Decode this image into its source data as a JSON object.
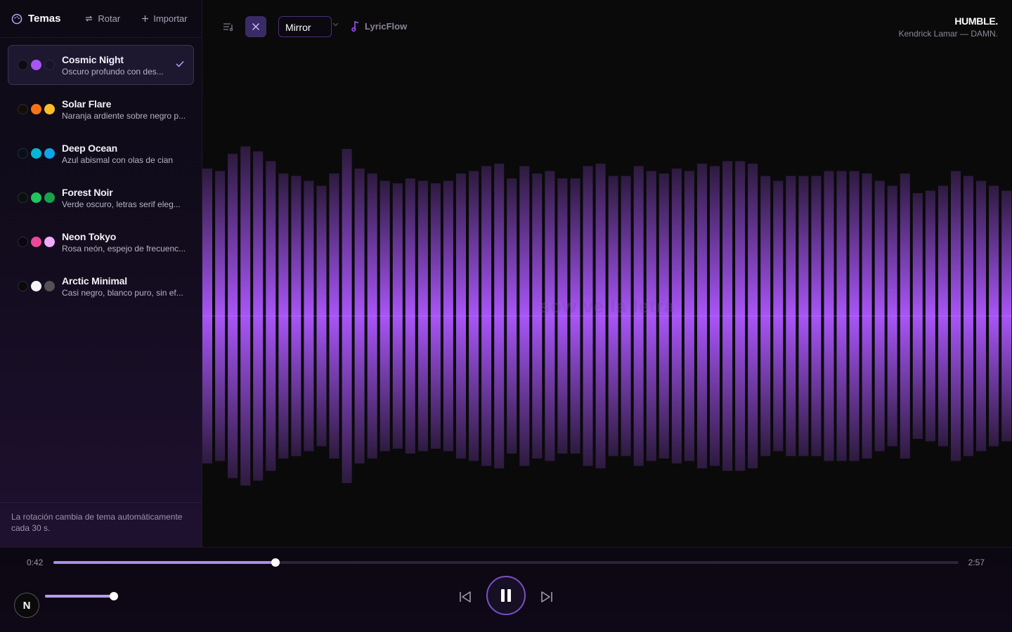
{
  "sidebar": {
    "tabs": {
      "temas": "Temas",
      "rotar": "Rotar",
      "importar": "Importar"
    },
    "themes": [
      {
        "name": "Cosmic Night",
        "desc": "Oscuro profundo con des...",
        "active": true,
        "colors": [
          "#0e0a14",
          "#a855f7",
          "#1a1230"
        ]
      },
      {
        "name": "Solar Flare",
        "desc": "Naranja ardiente sobre negro p...",
        "active": false,
        "colors": [
          "#150c06",
          "#f97316",
          "#fbbf24"
        ]
      },
      {
        "name": "Deep Ocean",
        "desc": "Azul abismal con olas de cian",
        "active": false,
        "colors": [
          "#06101a",
          "#06b6d4",
          "#0ea5e9"
        ]
      },
      {
        "name": "Forest Noir",
        "desc": "Verde oscuro, letras serif eleg...",
        "active": false,
        "colors": [
          "#07110a",
          "#22c55e",
          "#16a34a"
        ]
      },
      {
        "name": "Neon Tokyo",
        "desc": "Rosa neón, espejo de frecuenc...",
        "active": false,
        "colors": [
          "#0a0610",
          "#ec4899",
          "#f0abfc"
        ]
      },
      {
        "name": "Arctic Minimal",
        "desc": "Casi negro, blanco puro, sin ef...",
        "active": false,
        "colors": [
          "#0a0a0a",
          "#f5f5f5",
          "#525252"
        ]
      }
    ],
    "footer": "La rotación cambia de tema automáticamente cada 30 s."
  },
  "topbar": {
    "mode": "Mirror",
    "app_name": "LyricFlow",
    "track_title": "HUMBLE.",
    "track_artist": "Kendrick Lamar — DAMN."
  },
  "visualizer": {
    "overlay_text": "sow ve la letra",
    "bar_color": "#a855f7",
    "levels": [
      0.6,
      0.59,
      0.66,
      0.69,
      0.67,
      0.63,
      0.58,
      0.57,
      0.55,
      0.53,
      0.58,
      0.68,
      0.6,
      0.58,
      0.55,
      0.54,
      0.56,
      0.55,
      0.54,
      0.55,
      0.58,
      0.59,
      0.61,
      0.62,
      0.56,
      0.61,
      0.58,
      0.59,
      0.56,
      0.56,
      0.61,
      0.62,
      0.57,
      0.57,
      0.61,
      0.59,
      0.58,
      0.6,
      0.59,
      0.62,
      0.61,
      0.63,
      0.63,
      0.62,
      0.57,
      0.55,
      0.57,
      0.57,
      0.57,
      0.59,
      0.59,
      0.59,
      0.58,
      0.55,
      0.53,
      0.58,
      0.5,
      0.51,
      0.53,
      0.59,
      0.57,
      0.55,
      0.53,
      0.51
    ]
  },
  "player": {
    "current_time": "0:42",
    "total_time": "2:57",
    "progress": 0.245,
    "volume": 1.0,
    "badge": "N"
  }
}
